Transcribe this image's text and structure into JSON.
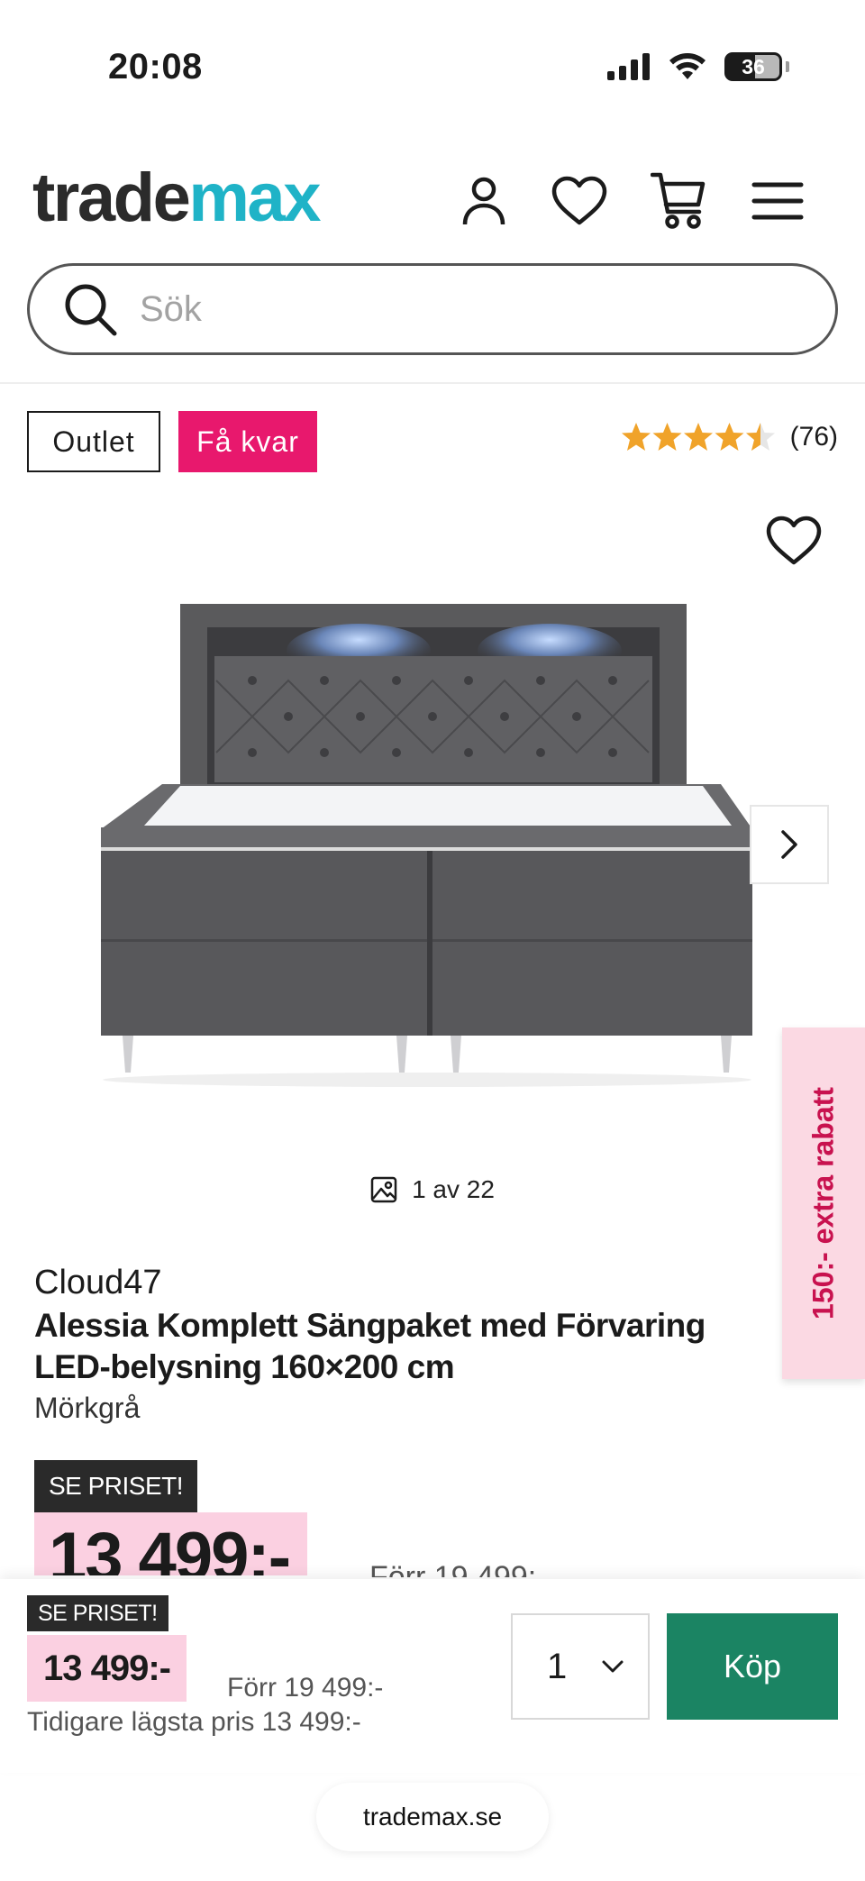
{
  "status_bar": {
    "time": "20:08",
    "battery": "36"
  },
  "header": {
    "logo_part1": "trade",
    "logo_part2": "max"
  },
  "search": {
    "placeholder": "Sök"
  },
  "badges": {
    "outlet": "Outlet",
    "few_left": "Få kvar"
  },
  "rating": {
    "stars": 4.5,
    "count": "(76)",
    "star_color": "#f0a32a"
  },
  "gallery": {
    "counter": "1 av 22"
  },
  "promo": {
    "label": "150:- extra rabatt"
  },
  "product": {
    "brand": "Cloud47",
    "title": "Alessia Komplett Sängpaket med Förvaring LED-belysning 160×200 cm",
    "variant": "Mörkgrå"
  },
  "price": {
    "badge": "SE PRISET!",
    "current": "13 499:-",
    "previous": "Förr 19 499:-"
  },
  "sticky_bar": {
    "badge": "SE PRISET!",
    "price": "13 499:-",
    "previous": "Förr 19 499:-",
    "lowest": "Tidigare lägsta pris 13 499:-",
    "quantity": "1",
    "buy_label": "Köp"
  },
  "browser": {
    "url": "trademax.se"
  },
  "colors": {
    "brand_teal": "#1fb3c7",
    "pink_badge": "#e8186d",
    "buy_green": "#1b8463",
    "price_highlight": "#fbd0e1"
  }
}
